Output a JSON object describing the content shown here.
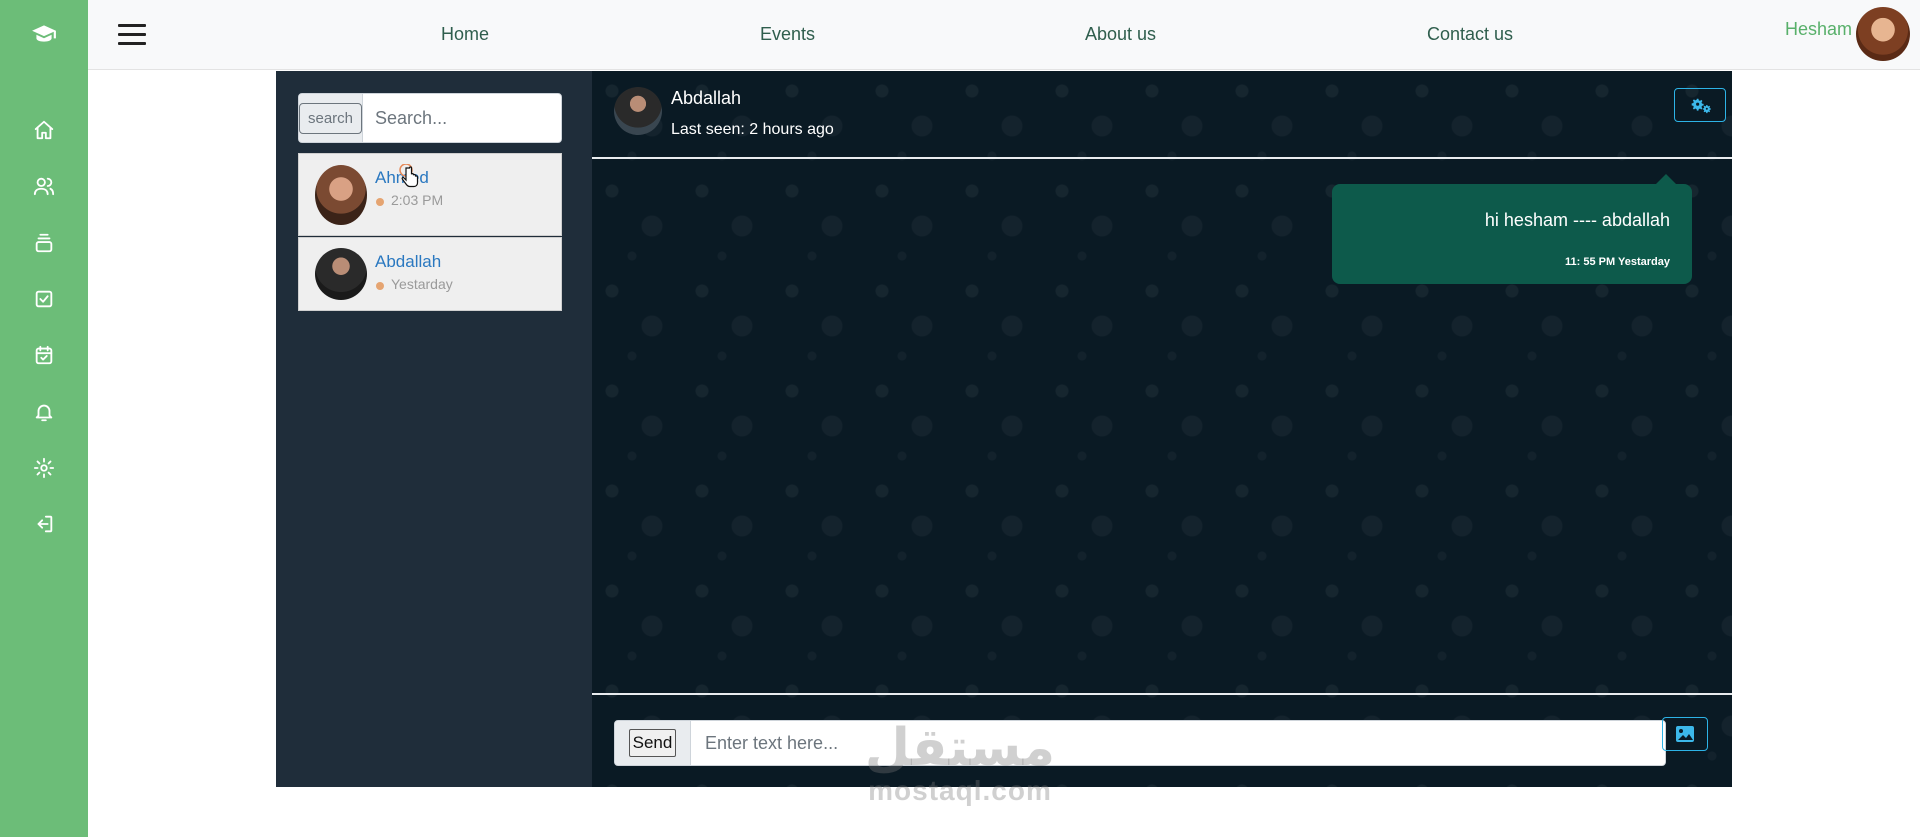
{
  "nav": {
    "links": [
      "Home",
      "Events",
      "About us",
      "Contact us"
    ],
    "user_name": "Hesham"
  },
  "sidebar_icons": [
    "graduation-cap-icon",
    "home-icon",
    "users-icon",
    "layers-icon",
    "checkbox-icon",
    "calendar-check-icon",
    "bell-icon",
    "gear-icon",
    "logout-icon"
  ],
  "contacts_panel": {
    "search_button": "search",
    "search_placeholder": "Search...",
    "contacts": [
      {
        "name": "Ahmed",
        "time": "2:03 PM"
      },
      {
        "name": "Abdallah",
        "time": "Yestarday"
      }
    ]
  },
  "chat": {
    "name": "Abdallah",
    "status": "Last seen: 2 hours ago",
    "messages": [
      {
        "text": "hi hesham ---- abdallah",
        "time": "11: 55 PM Yestarday"
      }
    ],
    "send_label": "Send",
    "input_placeholder": "Enter text here..."
  },
  "watermark": {
    "arabic": "مستقل",
    "latin": "mostaql.com"
  },
  "colors": {
    "rail": "#6cbd78",
    "panel": "#1f2d3a",
    "chat_bg": "#0a1a24",
    "bubble": "#0d5a4b",
    "accent": "#2db3e6"
  }
}
